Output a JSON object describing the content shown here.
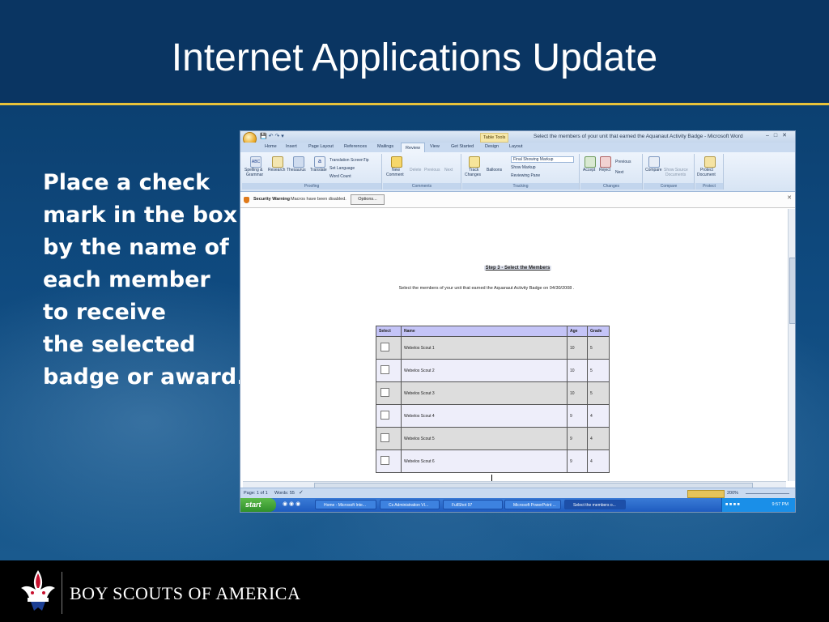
{
  "slide": {
    "title": "Internet Applications Update",
    "body_lines": [
      "Place a check",
      "mark in the box",
      "by the name of",
      "each member",
      "to receive",
      "the selected",
      "badge or award."
    ],
    "footer_org": "BOY SCOUTS OF AMERICA",
    "colors": {
      "background": "#0b3a67",
      "title_rule": "#e8c23a",
      "footer": "#000000"
    }
  },
  "word": {
    "context_tab": "Table Tools",
    "window_title": "Select the members of your unit that earned the Aquanaut Activity Badge - Microsoft Word",
    "tabs": [
      "Home",
      "Insert",
      "Page Layout",
      "References",
      "Mailings",
      "Review",
      "View",
      "Get Started",
      "Design",
      "Layout"
    ],
    "active_tab": "Review",
    "ribbon": {
      "proofing": {
        "label": "Proofing",
        "spelling": "Spelling &",
        "grammar": "Grammar",
        "research": "Research",
        "thesaurus": "Thesaurus",
        "translate": "Translate",
        "translation_tip": "Translation ScreenTip",
        "set_language": "Set Language",
        "word_count": "Word Count"
      },
      "comments": {
        "label": "Comments",
        "new": "New",
        "comment": "Comment",
        "delete": "Delete",
        "previous": "Previous",
        "next": "Next"
      },
      "tracking": {
        "label": "Tracking",
        "track": "Track",
        "changes": "Changes",
        "balloons": "Balloons",
        "final_showing": "Final Showing Markup",
        "show_markup": "Show Markup",
        "reviewing_pane": "Reviewing Pane"
      },
      "changes": {
        "label": "Changes",
        "accept": "Accept",
        "reject": "Reject",
        "previous": "Previous",
        "next": "Next"
      },
      "compare": {
        "label": "Compare",
        "compare": "Compare",
        "show_source": "Show Source",
        "documents": "Documents"
      },
      "protect": {
        "label": "Protect",
        "protect": "Protect",
        "document": "Document"
      }
    },
    "security": {
      "warning": "Security Warning",
      "message": "Macros have been disabled.",
      "options_button": "Options..."
    },
    "document": {
      "step_title": "Step 3 - Select the Members",
      "instruction": "Select the members of your unit that earned the Aquanaut Activity Badge on 04/30/2008 .",
      "table": {
        "headers": [
          "Select",
          "Name",
          "Age",
          "Grade"
        ],
        "rows": [
          {
            "name": "Webelos Scout 1",
            "age": "10",
            "grade": "5"
          },
          {
            "name": "Webelos Scout 2",
            "age": "10",
            "grade": "5"
          },
          {
            "name": "Webelos Scout 3",
            "age": "10",
            "grade": "5"
          },
          {
            "name": "Webelos Scout 4",
            "age": "9",
            "grade": "4"
          },
          {
            "name": "Webelos Scout 5",
            "age": "9",
            "grade": "4"
          },
          {
            "name": "Webelos Scout 6",
            "age": "9",
            "grade": "4"
          }
        ]
      }
    },
    "status": {
      "page": "Page: 1 of 1",
      "words": "Words: 55",
      "zoom": "200%"
    },
    "taskbar": {
      "start": "start",
      "buttons": [
        "Home - Microsoft Inte...",
        "Cs Administration VI...",
        "FullShot 97",
        "Microsoft PowerPoint ...",
        "Select the members o..."
      ],
      "clock": "9:57 PM"
    }
  }
}
